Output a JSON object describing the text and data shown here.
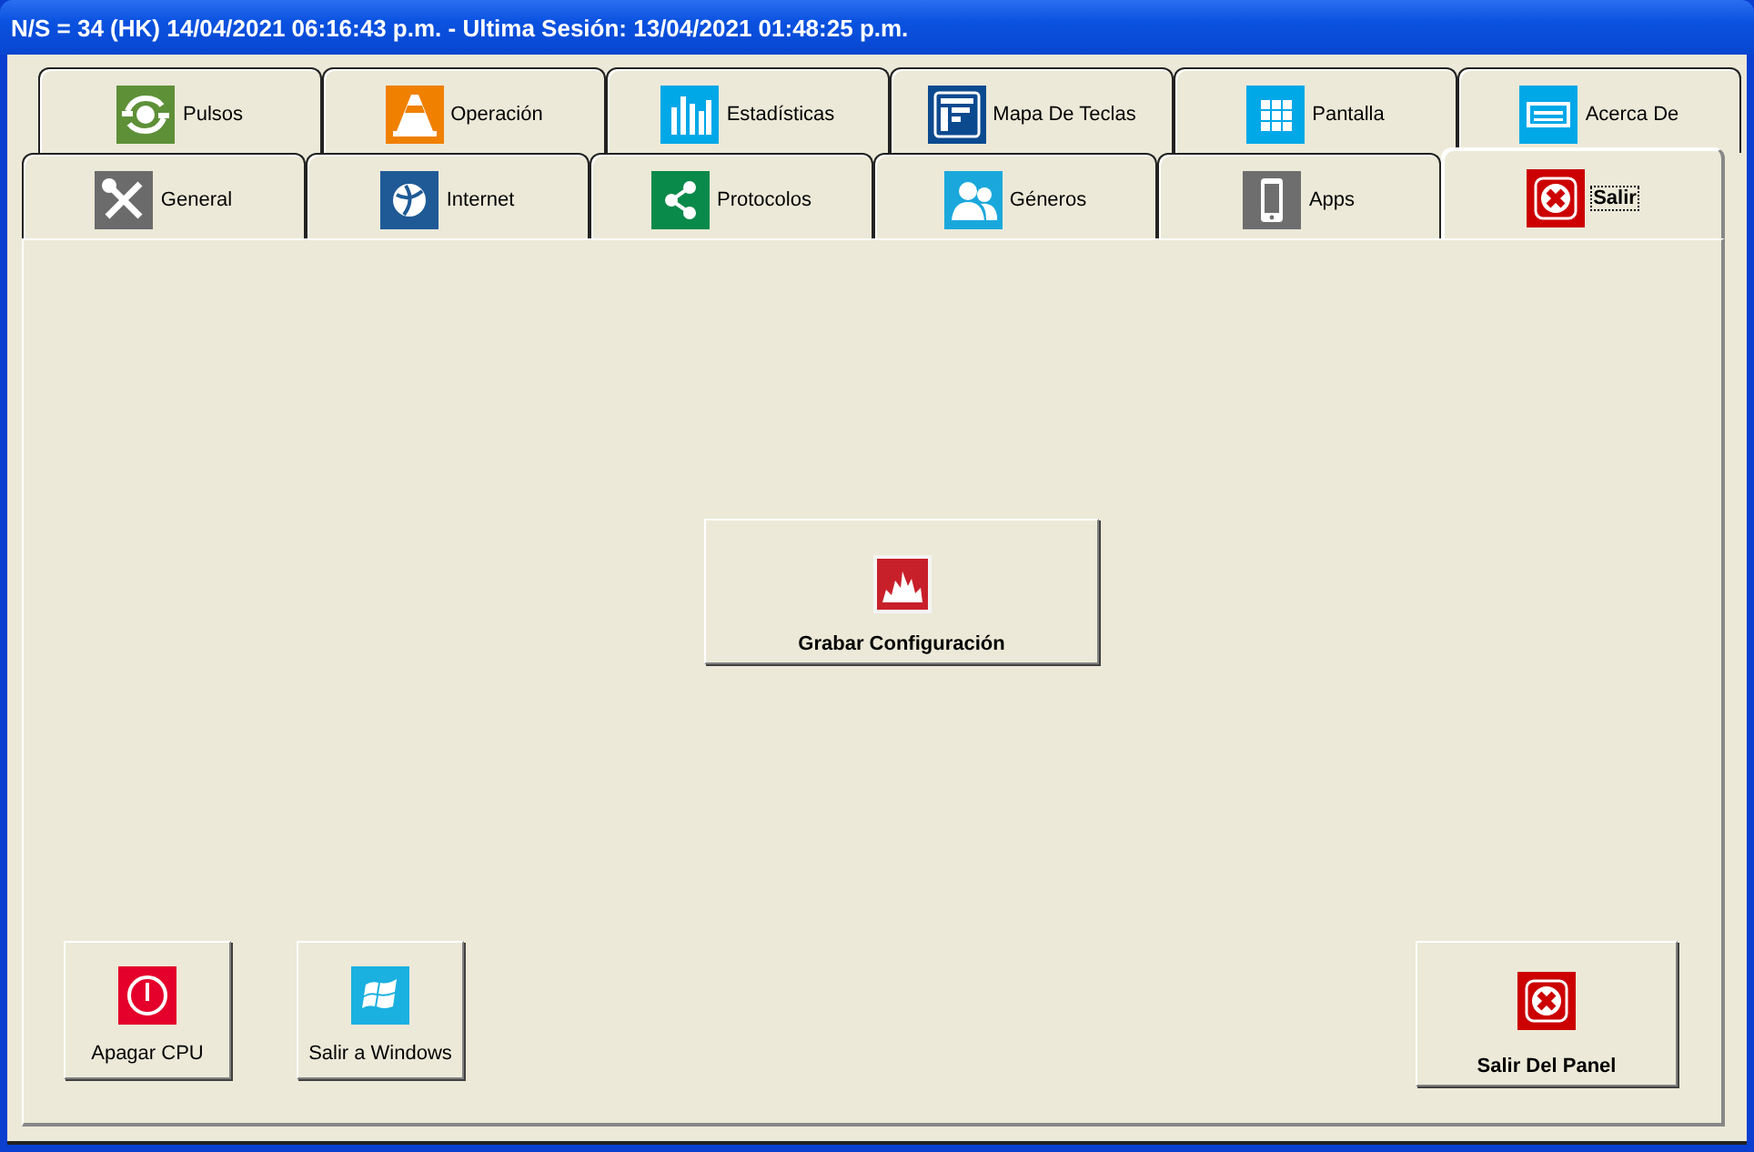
{
  "window": {
    "title": "N/S = 34 (HK) 14/04/2021 06:16:43 p.m. - Ultima Sesión: 13/04/2021 01:48:25 p.m."
  },
  "tab_rows": [
    {
      "tabs": [
        {
          "label": "Pulsos",
          "selected": false
        },
        {
          "label": "Operación",
          "selected": false
        },
        {
          "label": "Estadísticas",
          "selected": false
        },
        {
          "label": "Mapa De Teclas",
          "selected": false
        },
        {
          "label": "Pantalla",
          "selected": false
        },
        {
          "label": "Acerca De",
          "selected": false
        }
      ]
    },
    {
      "tabs": [
        {
          "label": "General",
          "selected": false
        },
        {
          "label": "Internet",
          "selected": false
        },
        {
          "label": "Protocolos",
          "selected": false
        },
        {
          "label": "Géneros",
          "selected": false
        },
        {
          "label": "Apps",
          "selected": false
        },
        {
          "label": "Salir",
          "selected": true
        }
      ]
    }
  ],
  "buttons": [
    {
      "label": "Grabar Configuración",
      "kind": "wide"
    },
    {
      "label": "Apagar CPU",
      "kind": "small"
    },
    {
      "label": "Salir a Windows",
      "kind": "small"
    },
    {
      "label": "Salir Del Panel",
      "kind": "wide"
    }
  ]
}
